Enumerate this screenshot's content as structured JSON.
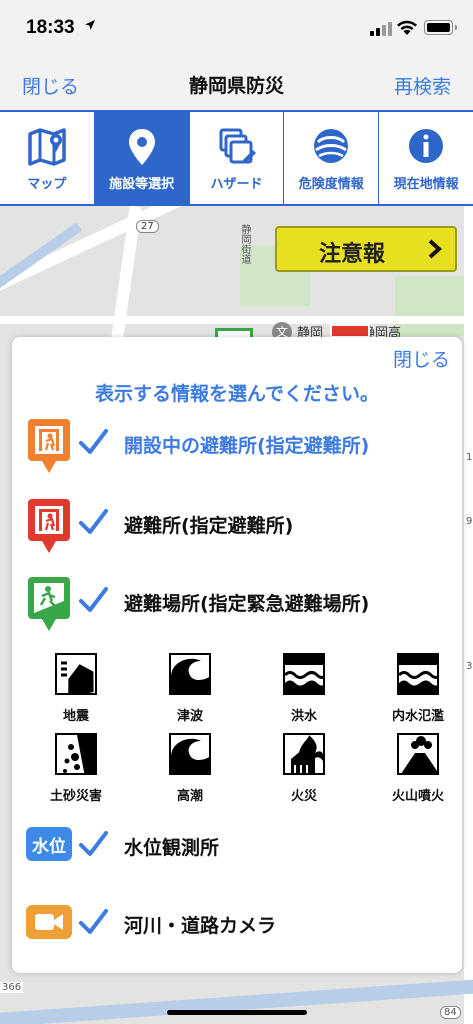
{
  "status_bar": {
    "time": "18:33"
  },
  "navbar": {
    "left": "閉じる",
    "title": "静岡県防災",
    "right": "再検索"
  },
  "tabs": [
    {
      "label": "マップ",
      "icon": "map-icon",
      "active": false
    },
    {
      "label": "施設等選択",
      "icon": "location-pin-icon",
      "active": true
    },
    {
      "label": "ハザード",
      "icon": "layers-icon",
      "active": false
    },
    {
      "label": "危険度情報",
      "icon": "globe-icon",
      "active": false
    },
    {
      "label": "現在地情報",
      "icon": "info-icon",
      "active": false
    }
  ],
  "map": {
    "caution_button": "注意報",
    "labels": {
      "route": "27",
      "station1": "静岡",
      "station2": "静岡高",
      "road": "静岡街道",
      "bottom_left": "366",
      "bottom_right": "84",
      "right_edge": "1",
      "right_edge2": "9",
      "right_edge3": "3"
    }
  },
  "modal": {
    "close": "閉じる",
    "heading": "表示する情報を選んでください。",
    "rows": [
      {
        "label": "開設中の避難所(指定避難所)",
        "checked": true,
        "icon": "open-shelter-pin-icon",
        "color": "#f07f2e",
        "highlight": true
      },
      {
        "label": "避難所(指定避難所)",
        "checked": true,
        "icon": "shelter-pin-icon",
        "color": "#e03a2f",
        "highlight": false
      },
      {
        "label": "避難場所(指定緊急避難場所)",
        "checked": true,
        "icon": "evacuation-site-pin-icon",
        "color": "#3aa649",
        "highlight": false
      }
    ],
    "hazards": [
      {
        "label": "地震",
        "icon": "earthquake-icon"
      },
      {
        "label": "津波",
        "icon": "tsunami-icon"
      },
      {
        "label": "洪水",
        "icon": "flood-icon"
      },
      {
        "label": "内水氾濫",
        "icon": "inland-flood-icon"
      },
      {
        "label": "土砂災害",
        "icon": "landslide-icon"
      },
      {
        "label": "高潮",
        "icon": "storm-surge-icon"
      },
      {
        "label": "火災",
        "icon": "fire-icon"
      },
      {
        "label": "火山噴火",
        "icon": "volcano-icon"
      }
    ],
    "water_level": {
      "badge": "水位",
      "label": "水位観測所",
      "checked": true,
      "color": "#3d8be6"
    },
    "camera": {
      "label": "河川・道路カメラ",
      "checked": true,
      "color": "#ef9f36"
    }
  }
}
